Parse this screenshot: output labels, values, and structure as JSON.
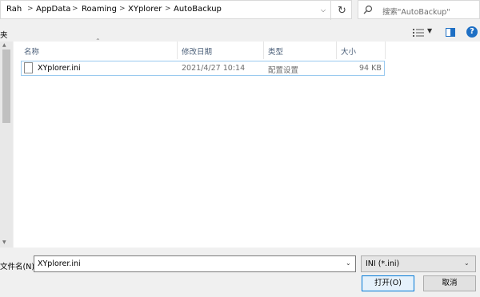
{
  "breadcrumb": [
    "Rah",
    "AppData",
    "Roaming",
    "XYplorer",
    "AutoBackup"
  ],
  "search": {
    "placeholder": "搜索\"AutoBackup\""
  },
  "toolbar": {
    "left_label": "夹"
  },
  "columns": {
    "name": "名称",
    "date": "修改日期",
    "type": "类型",
    "size": "大小"
  },
  "file": {
    "name": "XYplorer.ini",
    "date": "2021/4/27 10:14",
    "type": "配置设置",
    "size": "94 KB"
  },
  "bottom": {
    "filename_label": "文件名(N):",
    "filename_value": "XYplorer.ini",
    "filetype_value": "INI (*.ini)",
    "open_label": "打开(O)",
    "cancel_label": "取消"
  },
  "icons": {
    "help": "?"
  },
  "colors": {
    "accent": "#0078d7",
    "help": "#1e6fc4",
    "header_text": "#4c607a"
  }
}
